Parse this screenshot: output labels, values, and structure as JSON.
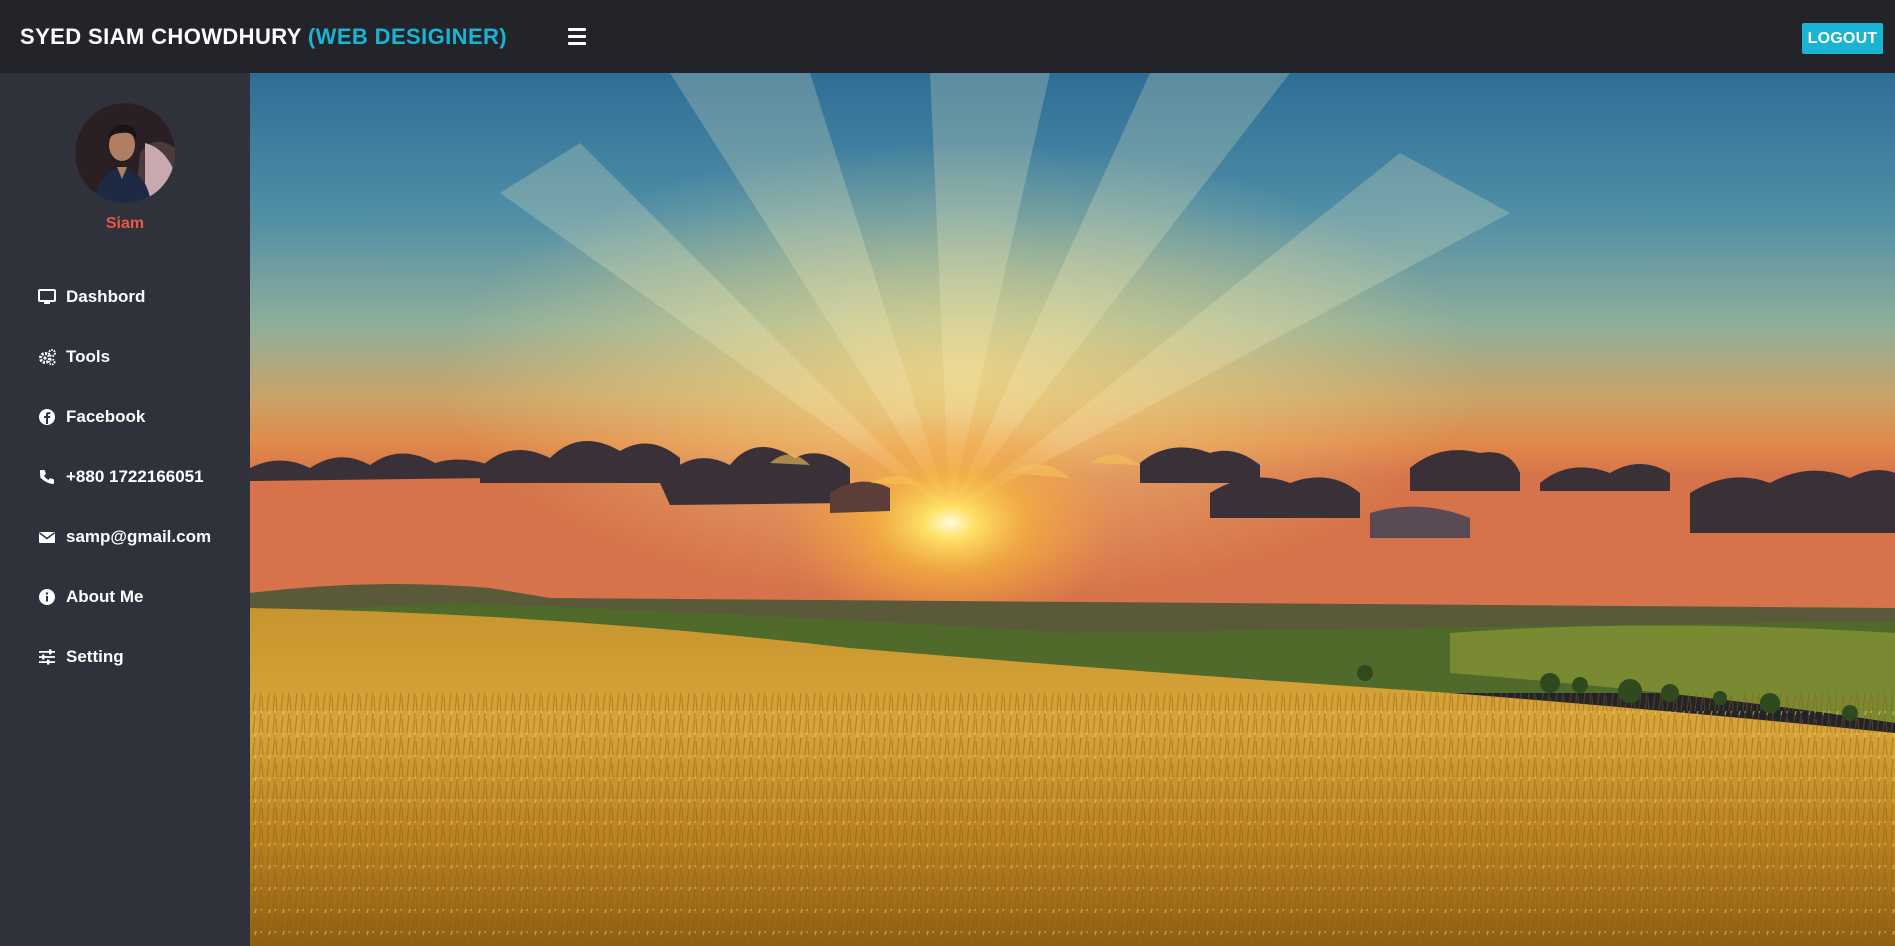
{
  "header": {
    "name": "SYED SIAM CHOWDHURY",
    "role": "(WEB DESIGINER)",
    "logout_label": "LOGOUT",
    "menu_icon": "hamburger-icon"
  },
  "profile": {
    "name": "Siam"
  },
  "sidebar": {
    "items": [
      {
        "label": "Dashbord",
        "icon": "monitor-icon"
      },
      {
        "label": "Tools",
        "icon": "gears-icon"
      },
      {
        "label": "Facebook",
        "icon": "facebook-icon"
      },
      {
        "label": "+880 1722166051",
        "icon": "phone-icon"
      },
      {
        "label": "samp@gmail.com",
        "icon": "envelope-icon"
      },
      {
        "label": "About Me",
        "icon": "info-icon"
      },
      {
        "label": "Setting",
        "icon": "sliders-icon"
      }
    ]
  },
  "colors": {
    "topbar": "#22242a",
    "sidebar": "#2f323a",
    "accent": "#19b3d3",
    "profile_name": "#e8584a"
  }
}
